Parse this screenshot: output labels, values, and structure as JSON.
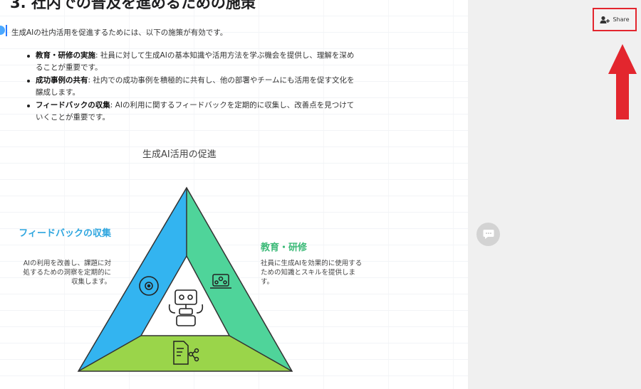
{
  "document": {
    "heading": "3. 社内での普及を進めるための施策",
    "intro": "生成AIの社内活用を促進するためには、以下の施策が有効です。",
    "bullets": [
      {
        "label": "教育・研修の実施",
        "text": ": 社員に対して生成AIの基本知識や活用方法を学ぶ機会を提供し、理解を深めることが重要です。"
      },
      {
        "label": "成功事例の共有",
        "text": ": 社内での成功事例を積極的に共有し、他の部署やチームにも活用を促す文化を醸成します。"
      },
      {
        "label": "フィードバックの収集",
        "text": ": AIの利用に関するフィードバックを定期的に収集し、改善点を見つけていくことが重要です。"
      }
    ]
  },
  "diagram": {
    "title": "生成AI活用の促進",
    "left": {
      "title": "フィードバックの収集",
      "desc": "AIの利用を改善し、課題に対処するための洞察を定期的に収集します。"
    },
    "right": {
      "title": "教育・研修",
      "desc": "社員に生成AIを効果的に使用するための知識とスキルを提供します。"
    },
    "colors": {
      "left": "#33b4f0",
      "right": "#4fd49a",
      "bottom": "#9ad54a"
    },
    "icons": [
      "target-icon",
      "laptop-team-icon",
      "robot-icon",
      "document-share-icon"
    ]
  },
  "sidebar": {
    "share_label": "Share",
    "icons": [
      "add-person-icon",
      "chat-icon"
    ],
    "highlight_color": "#e3262e"
  }
}
